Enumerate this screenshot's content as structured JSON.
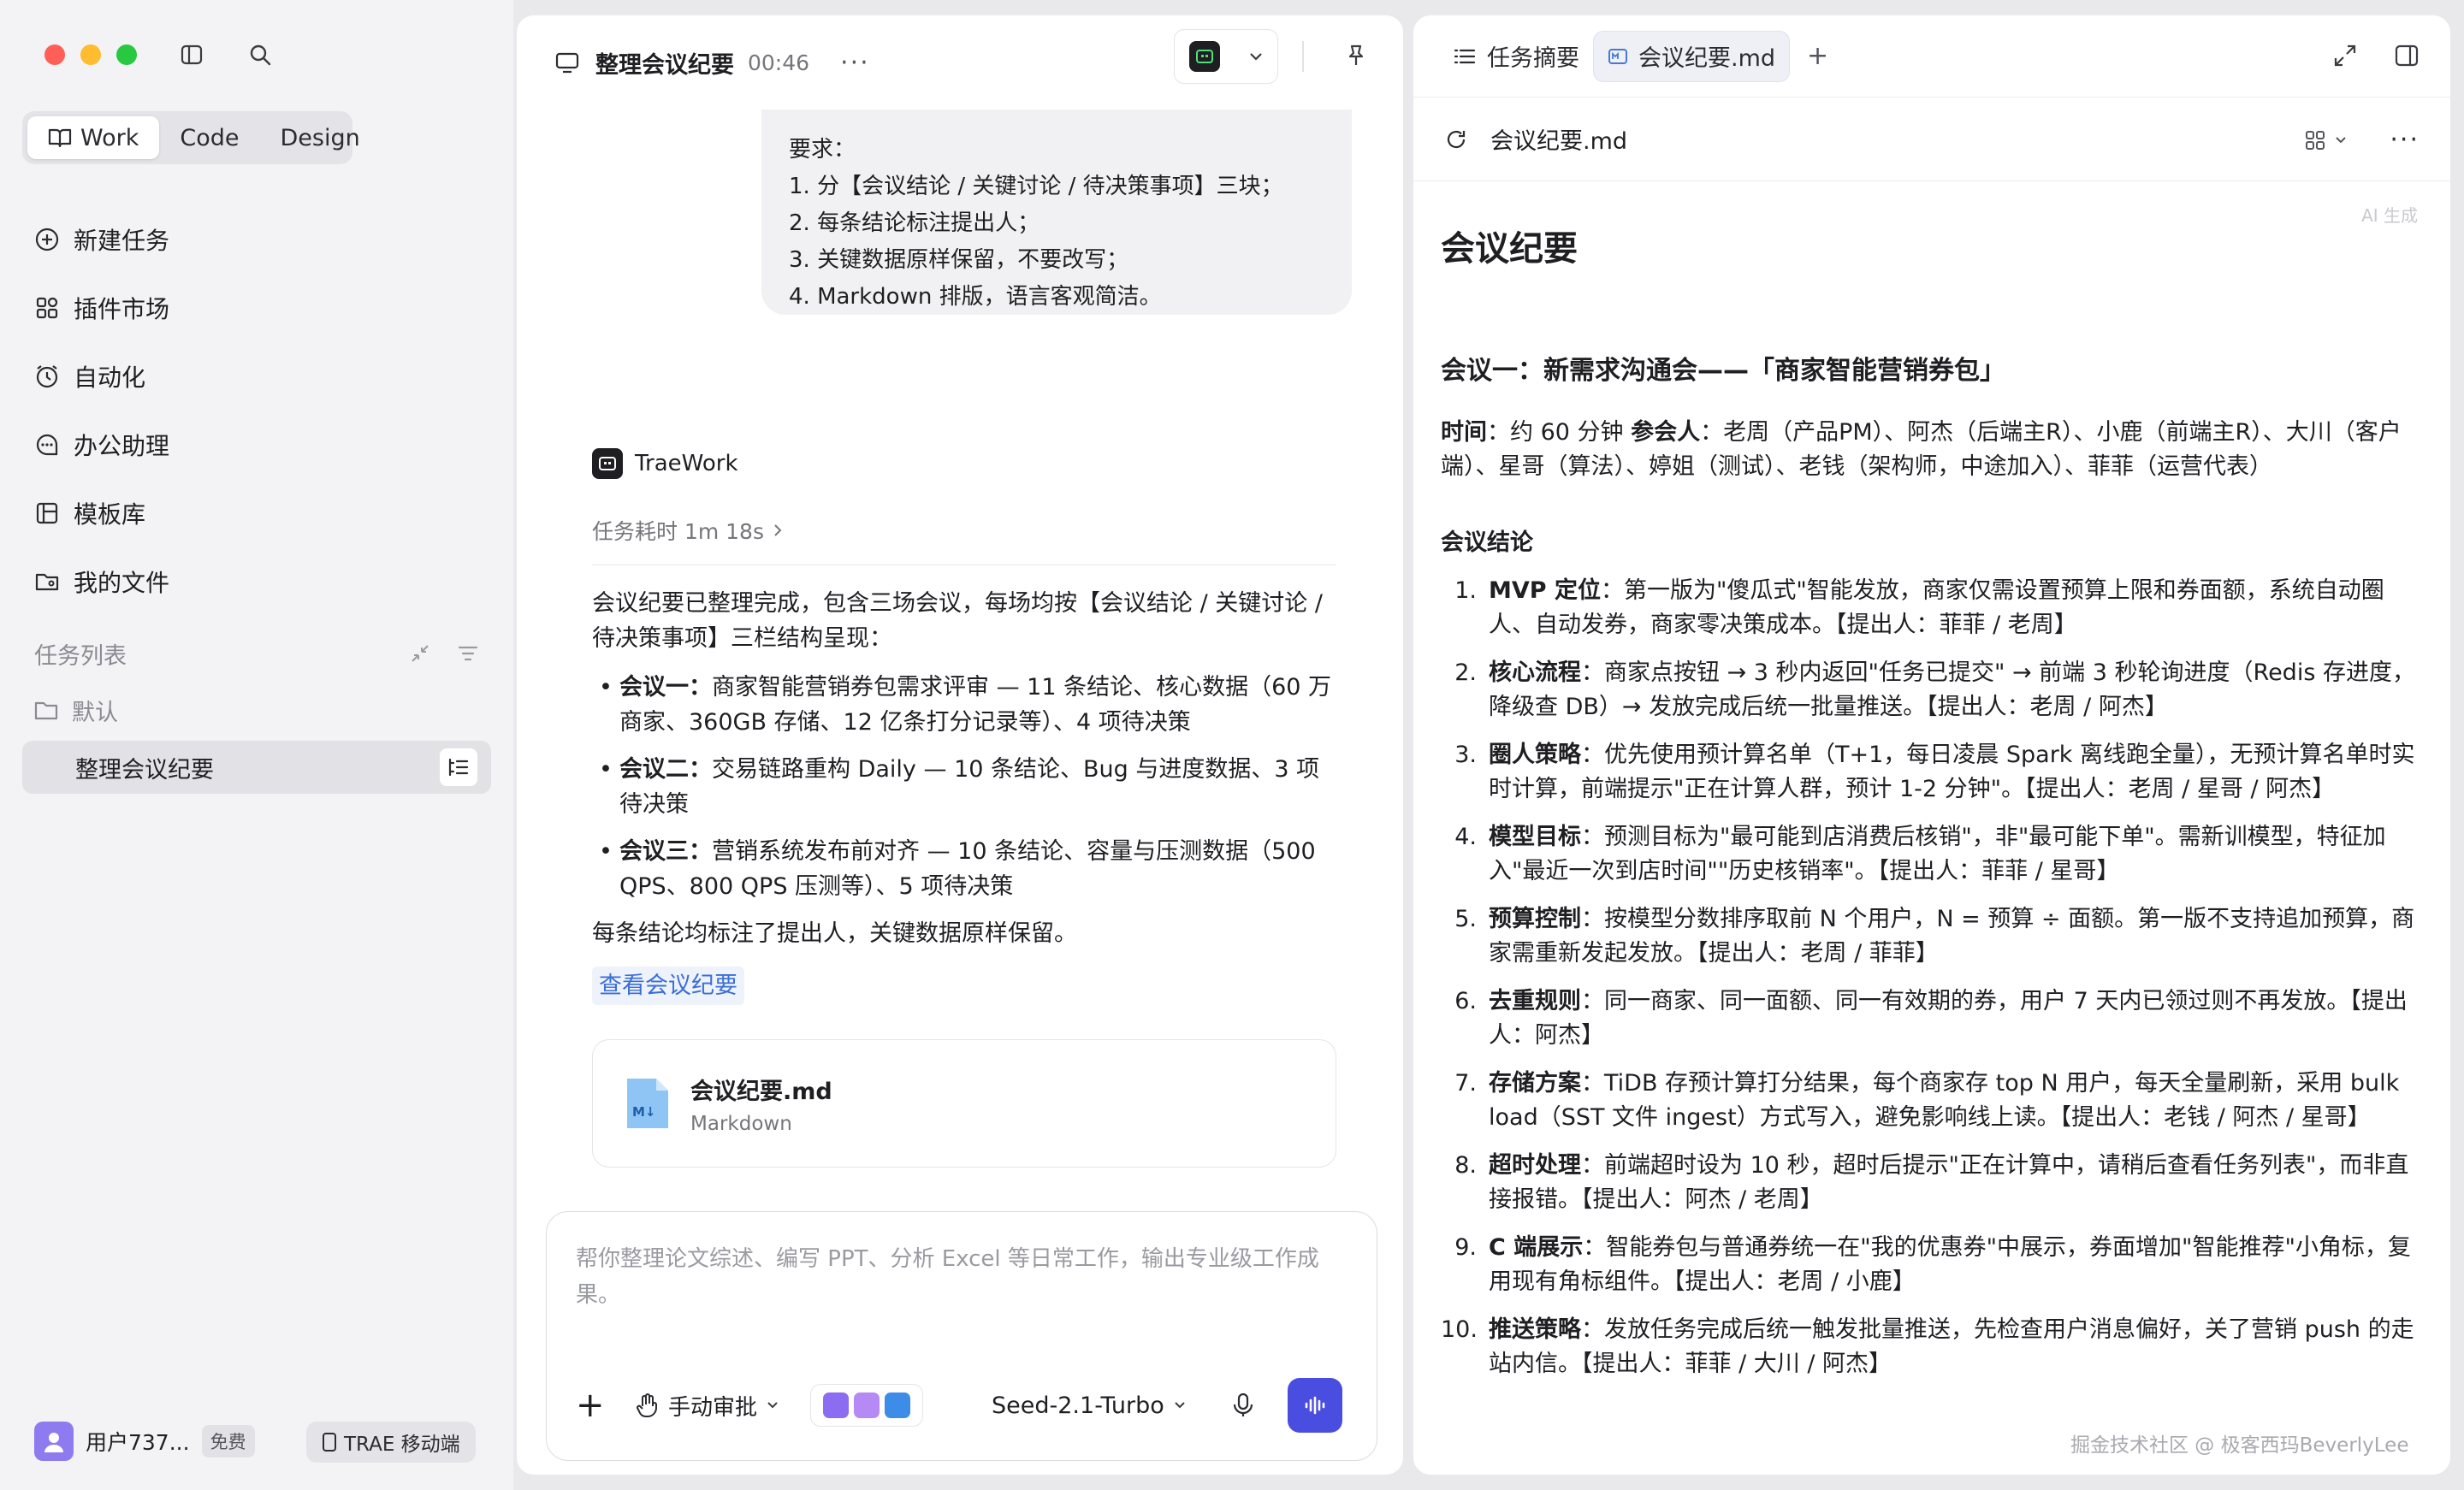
{
  "sidebar": {
    "modes": [
      "Work",
      "Code",
      "Design"
    ],
    "nav": [
      "新建任务",
      "插件市场",
      "自动化",
      "办公助理",
      "模板库",
      "我的文件"
    ],
    "task_list_title": "任务列表",
    "folder": "默认",
    "active_task": "整理会议纪要",
    "user_name": "用户737...",
    "user_badge": "免费",
    "mobile_label": "TRAE 移动端"
  },
  "chat": {
    "title": "整理会议纪要",
    "time": "00:46",
    "user_message": [
      "要求：",
      "1. 分【会议结论 / 关键讨论 / 待决策事项】三块；",
      "2. 每条结论标注提出人；",
      "3. 关键数据原样保留，不要改写；",
      "4. Markdown 排版，语言客观简洁。"
    ],
    "assistant_name": "TraeWork",
    "duration": "任务耗时 1m 18s",
    "intro": "会议纪要已整理完成，包含三场会议，每场均按【会议结论 / 关键讨论 / 待决策事项】三栏结构呈现：",
    "bullets": [
      {
        "label": "会议一：",
        "text": "商家智能营销券包需求评审 — 11 条结论、核心数据（60 万商家、360GB 存储、12 亿条打分记录等）、4 项待决策"
      },
      {
        "label": "会议二：",
        "text": "交易链路重构 Daily — 10 条结论、Bug 与进度数据、3 项待决策"
      },
      {
        "label": "会议三：",
        "text": "营销系统发布前对齐 — 10 条结论、容量与压测数据（500 QPS、800 QPS 压测等）、5 项待决策"
      }
    ],
    "note": "每条结论均标注了提出人，关键数据原样保留。",
    "link": "查看会议纪要",
    "file_name": "会议纪要.md",
    "file_type": "Markdown",
    "composer_placeholder": "帮你整理论文综述、编写 PPT、分析 Excel 等日常工作，输出专业级工作成果。",
    "approval": "手动审批",
    "model": "Seed-2.1-Turbo"
  },
  "doc": {
    "tabs": [
      "任务摘要",
      "会议纪要.md"
    ],
    "toolbar_name": "会议纪要.md",
    "ai_tag": "AI 生成",
    "h1": "会议纪要",
    "h2": "会议一：新需求沟通会——「商家智能营销券包」",
    "meta_time_label": "时间",
    "meta_time": "：约 60 分钟 ",
    "meta_people_label": "参会人",
    "meta_people": "：老周（产品PM）、阿杰（后端主R）、小鹿（前端主R）、大川（客户端）、星哥（算法）、婷姐（测试）、老钱（架构师，中途加入）、菲菲（运营代表）",
    "h3": "会议结论",
    "items": [
      {
        "num": "1.",
        "label": "MVP 定位",
        "text": "：第一版为\"傻瓜式\"智能发放，商家仅需设置预算上限和券面额，系统自动圈人、自动发券，商家零决策成本。【提出人：菲菲 / 老周】"
      },
      {
        "num": "2.",
        "label": "核心流程",
        "text": "：商家点按钮 → 3 秒内返回\"任务已提交\" → 前端 3 秒轮询进度（Redis 存进度，降级查 DB）→ 发放完成后统一批量推送。【提出人：老周 / 阿杰】"
      },
      {
        "num": "3.",
        "label": "圈人策略",
        "text": "：优先使用预计算名单（T+1，每日凌晨 Spark 离线跑全量），无预计算名单时实时计算，前端提示\"正在计算人群，预计 1-2 分钟\"。【提出人：老周 / 星哥 / 阿杰】"
      },
      {
        "num": "4.",
        "label": "模型目标",
        "text": "：预测目标为\"最可能到店消费后核销\"，非\"最可能下单\"。需新训模型，特征加入\"最近一次到店时间\"\"历史核销率\"。【提出人：菲菲 / 星哥】"
      },
      {
        "num": "5.",
        "label": "预算控制",
        "text": "：按模型分数排序取前 N 个用户，N = 预算 ÷ 面额。第一版不支持追加预算，商家需重新发起发放。【提出人：老周 / 菲菲】"
      },
      {
        "num": "6.",
        "label": "去重规则",
        "text": "：同一商家、同一面额、同一有效期的券，用户 7 天内已领过则不再发放。【提出人：阿杰】"
      },
      {
        "num": "7.",
        "label": "存储方案",
        "text": "：TiDB 存预计算打分结果，每个商家存 top N 用户，每天全量刷新，采用 bulk load（SST 文件 ingest）方式写入，避免影响线上读。【提出人：老钱 / 阿杰 / 星哥】"
      },
      {
        "num": "8.",
        "label": "超时处理",
        "text": "：前端超时设为 10 秒，超时后提示\"正在计算中，请稍后查看任务列表\"，而非直接报错。【提出人：阿杰 / 老周】"
      },
      {
        "num": "9.",
        "label": "C 端展示",
        "text": "：智能券包与普通券统一在\"我的优惠券\"中展示，券面增加\"智能推荐\"小角标，复用现有角标组件。【提出人：老周 / 小鹿】"
      },
      {
        "num": "10.",
        "label": "推送策略",
        "text": "：发放任务完成后统一触发批量推送，先检查用户消息偏好，关了营销 push 的走站内信。【提出人：菲菲 / 大川 / 阿杰】"
      }
    ]
  },
  "watermark": "掘金技术社区 @ 极客西玛BeverlyLee"
}
